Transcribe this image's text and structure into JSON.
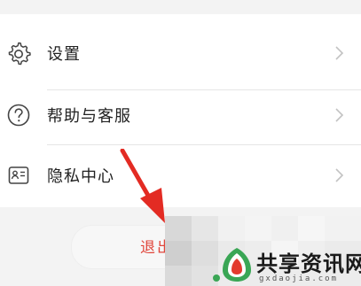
{
  "menu": {
    "items": [
      {
        "label": "设置",
        "icon": "gear-icon"
      },
      {
        "label": "帮助与客服",
        "icon": "help-circle-icon"
      },
      {
        "label": "隐私中心",
        "icon": "privacy-card-icon"
      }
    ]
  },
  "logout": {
    "label": "退出"
  },
  "watermark": {
    "text": "共享资讯网",
    "url": "gxdaojia.com"
  },
  "colors": {
    "logout_text": "#e0463b",
    "arrow": "#e32b23",
    "watermark_green": "#3aa655"
  }
}
